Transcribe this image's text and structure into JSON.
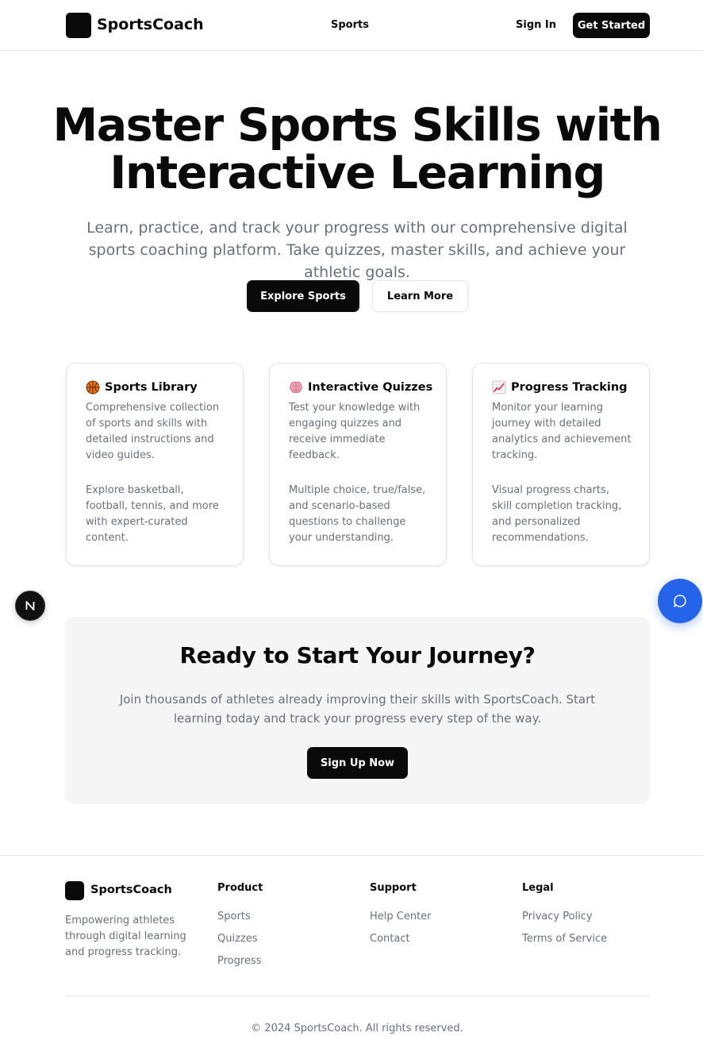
{
  "header": {
    "brand": "SportsCoach",
    "nav_sports": "Sports",
    "sign_in": "Sign In",
    "get_started": "Get Started"
  },
  "hero": {
    "title_line1": "Master Sports Skills with",
    "title_line2": "Interactive Learning",
    "subtitle": "Learn, practice, and track your progress with our comprehensive digital sports coaching platform. Take quizzes, master skills, and achieve your athletic goals.",
    "explore_button": "Explore Sports",
    "learn_more_button": "Learn More"
  },
  "features": [
    {
      "icon": "basketball-icon",
      "title": "Sports Library",
      "description": "Comprehensive collection of sports and skills with detailed instructions and video guides.",
      "body": "Explore basketball, football, tennis, and more with expert-curated content."
    },
    {
      "icon": "brain-icon",
      "title": "Interactive Quizzes",
      "description": "Test your knowledge with engaging quizzes and receive immediate feedback.",
      "body": "Multiple choice, true/false, and scenario-based questions to challenge your understanding."
    },
    {
      "icon": "chart-increasing-icon",
      "title": "Progress Tracking",
      "description": "Monitor your learning journey with detailed analytics and achievement tracking.",
      "body": "Visual progress charts, skill completion tracking, and personalized recommendations."
    }
  ],
  "cta": {
    "title": "Ready to Start Your Journey?",
    "text": "Join thousands of athletes already improving their skills with SportsCoach. Start learning today and track your progress every step of the way.",
    "button": "Sign Up Now"
  },
  "footer": {
    "brand": "SportsCoach",
    "tagline": "Empowering athletes through digital learning and progress tracking.",
    "product_heading": "Product",
    "product_links": [
      "Sports",
      "Quizzes",
      "Progress"
    ],
    "support_heading": "Support",
    "support_links": [
      "Help Center",
      "Contact"
    ],
    "legal_heading": "Legal",
    "legal_links": [
      "Privacy Policy",
      "Terms of Service"
    ],
    "copyright": "© 2024 SportsCoach. All rights reserved."
  },
  "colors": {
    "primary": "#0a0a0a",
    "muted_text": "#6b6f76",
    "chat_button": "#2563eb",
    "cta_background": "#f5f5f5"
  },
  "widgets": {
    "dev_badge_icon": "nextjs-logo-icon",
    "chat_icon": "chat-bubble-icon"
  }
}
